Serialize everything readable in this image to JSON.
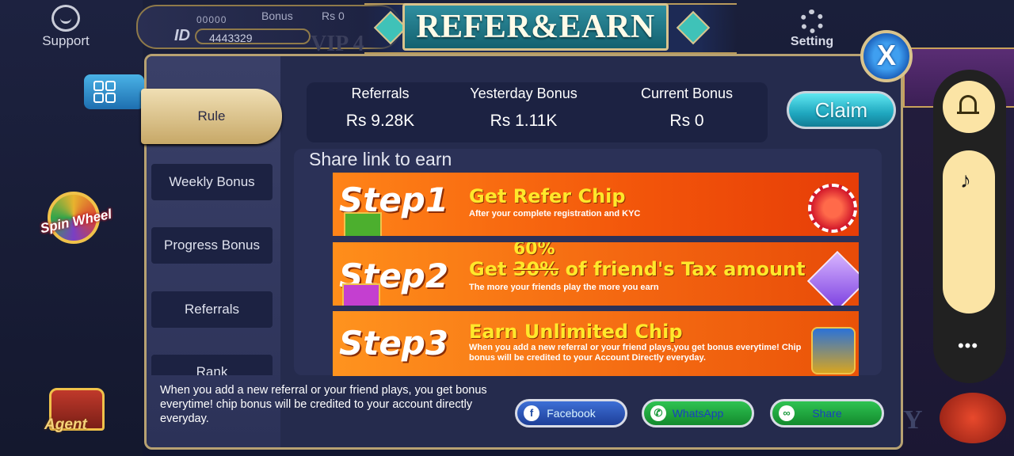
{
  "lobby": {
    "support_label": "Support",
    "user_stars": "00000",
    "user_id_label": "ID",
    "user_id": "4443329",
    "bonus_label": "Bonus",
    "balance": "Rs  0",
    "vip_label": "VIP 4",
    "setting_label": "Setting",
    "spin_wheel_label": "Spin Wheel",
    "agent_label": "Agent"
  },
  "title": "REFER&EARN",
  "sidebar": {
    "tabs": [
      {
        "label": "Rule",
        "active": true
      },
      {
        "label": "Weekly Bonus",
        "active": false
      },
      {
        "label": "Progress Bonus",
        "active": false
      },
      {
        "label": "Referrals",
        "active": false
      },
      {
        "label": "Rank",
        "active": false
      }
    ]
  },
  "stats": [
    {
      "label": "Referrals",
      "value": "Rs  9.28K"
    },
    {
      "label": "Yesterday Bonus",
      "value": "Rs  1.11K"
    },
    {
      "label": "Current Bonus",
      "value": "Rs  0"
    }
  ],
  "claim_label": "Claim",
  "share_label": "Share link to earn",
  "steps": [
    {
      "word": "Step1",
      "heading": "Get Refer Chip",
      "sub": "After your complete registration and KYC"
    },
    {
      "word": "Step2",
      "heading_prefix": "Get ",
      "old_pct": "30%",
      "new_pct": "60%",
      "heading_suffix": " of friend's Tax amount",
      "sub": "The more your friends play the more you earn"
    },
    {
      "word": "Step3",
      "heading": "Earn Unlimited Chip",
      "sub": "When you add a new referral or your friend plays,you get bonus everytime! Chip bonus will be credited to your Account Directly everyday."
    }
  ],
  "footnote": "When you add a new referral or your friend plays, you get bonus everytime! chip bonus will be credited to your account directly everyday.",
  "share_buttons": [
    {
      "label": "Facebook",
      "icon": "facebook-icon"
    },
    {
      "label": "WhatsApp",
      "icon": "whatsapp-icon"
    },
    {
      "label": "Share",
      "icon": "link-icon"
    }
  ],
  "close_glyph": "X",
  "overlay": {
    "more_glyph": "•••",
    "music_glyph": "♪",
    "bell_icon": "bell-icon"
  },
  "colors": {
    "accent_gold": "#c7a867",
    "claim_cyan": "#1fa7bf",
    "step_orange": "#f2540a",
    "step_heading": "#ffe82b"
  }
}
